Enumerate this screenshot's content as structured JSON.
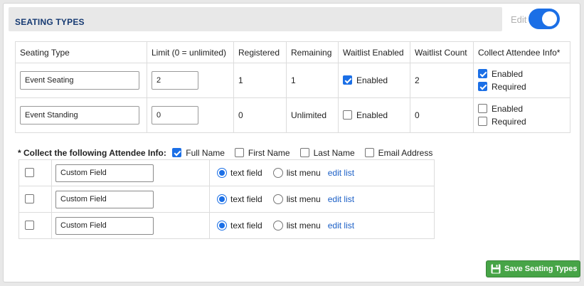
{
  "header": {
    "title": "SEATING TYPES",
    "edit_label": "Edit",
    "edit_toggle_on": true,
    "accent_color": "#1b6fe6"
  },
  "seating_table": {
    "columns": [
      "Seating Type",
      "Limit (0 = unlimited)",
      "Registered",
      "Remaining",
      "Waitlist Enabled",
      "Waitlist Count",
      "Collect Attendee Info*"
    ],
    "rows": [
      {
        "name": "Event Seating",
        "limit": "2",
        "registered": "1",
        "remaining": "1",
        "waitlist_enabled": true,
        "waitlist_label": "Enabled",
        "waitlist_count": "2",
        "collect_enabled": true,
        "collect_enabled_label": "Enabled",
        "collect_required": true,
        "collect_required_label": "Required"
      },
      {
        "name": "Event Standing",
        "limit": "0",
        "registered": "0",
        "remaining": "Unlimited",
        "waitlist_enabled": false,
        "waitlist_label": "Enabled",
        "waitlist_count": "0",
        "collect_enabled": false,
        "collect_enabled_label": "Enabled",
        "collect_required": false,
        "collect_required_label": "Required"
      }
    ]
  },
  "collect_info": {
    "label": "* Collect the following Attendee Info:",
    "options": [
      {
        "label": "Full Name",
        "checked": true
      },
      {
        "label": "First Name",
        "checked": false
      },
      {
        "label": "Last Name",
        "checked": false
      },
      {
        "label": "Email Address",
        "checked": false
      }
    ]
  },
  "custom_fields": [
    {
      "checked": false,
      "name": "Custom Field",
      "type": "text field",
      "text_label": "text field",
      "list_label": "list menu",
      "edit_label": "edit list"
    },
    {
      "checked": false,
      "name": "Custom Field",
      "type": "text field",
      "text_label": "text field",
      "list_label": "list menu",
      "edit_label": "edit list"
    },
    {
      "checked": false,
      "name": "Custom Field",
      "type": "text field",
      "text_label": "text field",
      "list_label": "list menu",
      "edit_label": "edit list"
    }
  ],
  "save_button": {
    "label": "Save Seating Types",
    "icon": "floppy-disk-icon",
    "color": "#47a447"
  }
}
